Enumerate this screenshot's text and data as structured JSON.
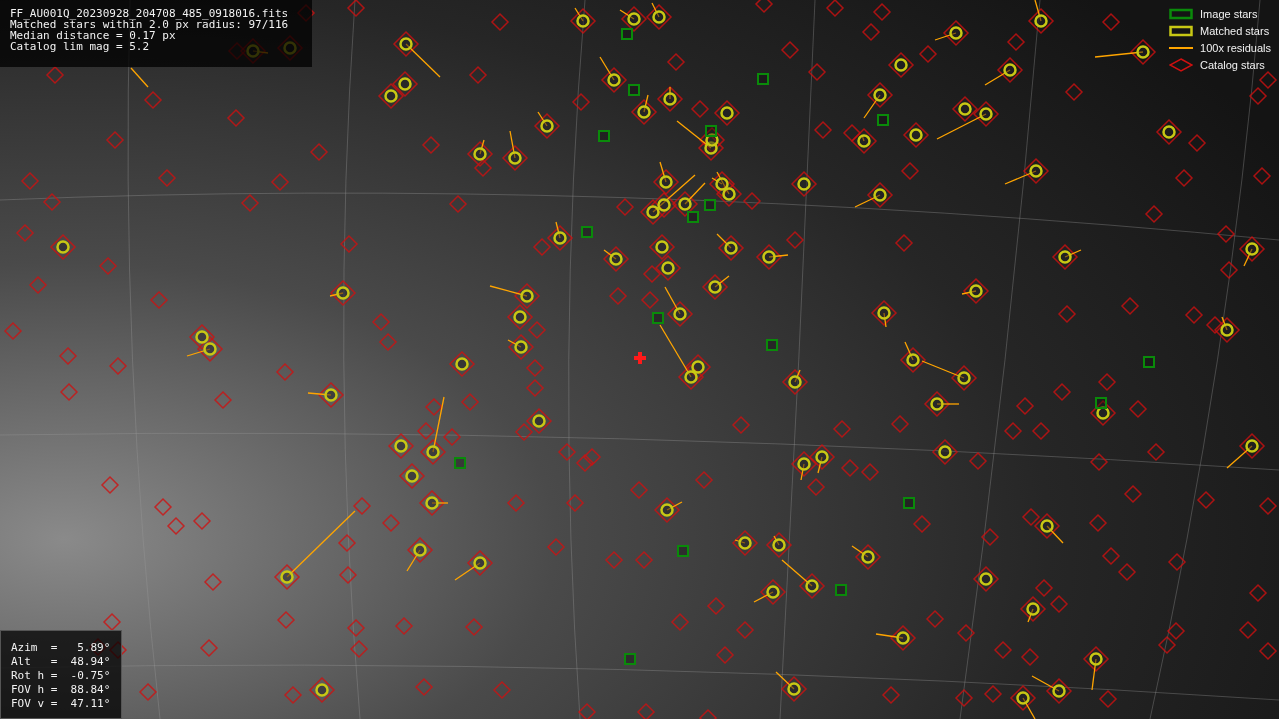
{
  "info_box": {
    "lines": [
      "FF_AU001Q_20230928_204708_485_0918016.fits",
      "Matched stars within 2.0 px radius: 97/116",
      "Median distance = 0.17 px",
      "Catalog lim mag = 5.2"
    ]
  },
  "pointing_box": {
    "lines": [
      "Azim  =   5.89°",
      "Alt   =  48.94°",
      "Rot h =  -0.75°",
      "FOV h =  88.84°",
      "FOV v =  47.11°"
    ]
  },
  "legend": [
    {
      "kind": "image",
      "label": "Image stars",
      "color": "#0a8a0a"
    },
    {
      "kind": "matched",
      "label": "Matched stars",
      "color": "#c8c814"
    },
    {
      "kind": "residual",
      "label": "100x residuals",
      "color": "#ffa500"
    },
    {
      "kind": "catalog",
      "label": "Catalog stars",
      "color": "#d01010"
    }
  ]
}
